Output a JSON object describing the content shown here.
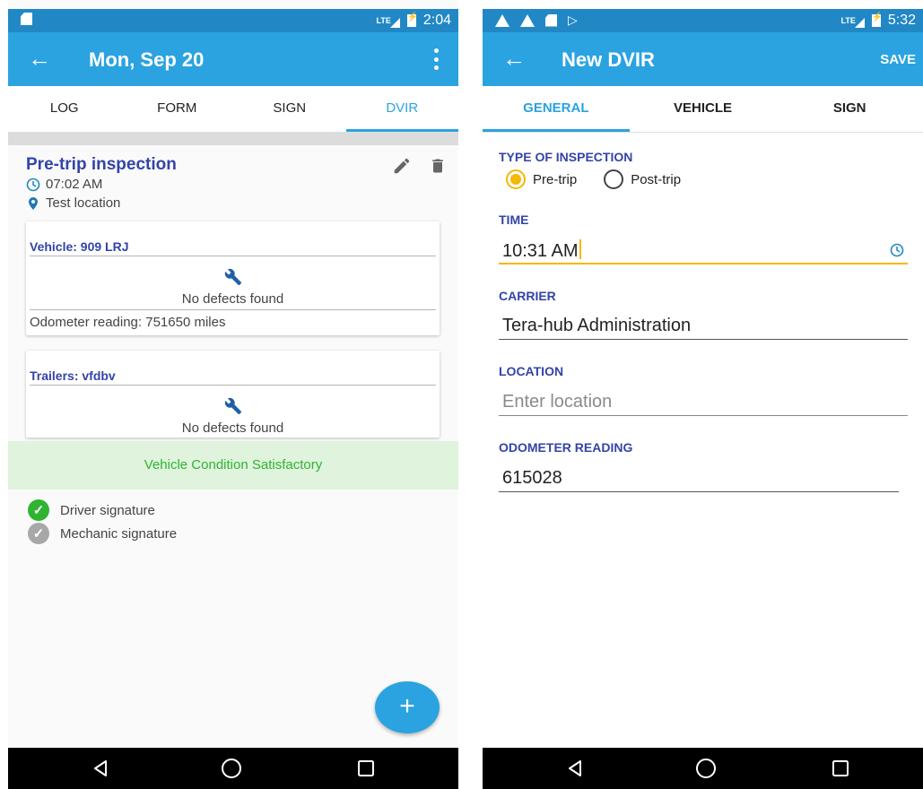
{
  "left": {
    "status": {
      "network": "LTE",
      "time": "2:04"
    },
    "appbar": {
      "title": "Mon, Sep 20"
    },
    "tabs": [
      "LOG",
      "FORM",
      "SIGN",
      "DVIR"
    ],
    "active_tab": "DVIR",
    "inspection": {
      "title": "Pre-trip inspection",
      "time": "07:02 AM",
      "location": "Test location"
    },
    "vehicle_card": {
      "title": "Vehicle: 909 LRJ",
      "defects": "No defects found",
      "odometer": "Odometer reading: 751650 miles"
    },
    "trailer_card": {
      "title": "Trailers: vfdbv",
      "defects": "No defects found"
    },
    "condition": "Vehicle Condition Satisfactory",
    "signatures": {
      "driver": "Driver signature",
      "mechanic": "Mechanic signature"
    },
    "fab_label": "+"
  },
  "right": {
    "status": {
      "network": "LTE",
      "time": "5:32"
    },
    "appbar": {
      "title": "New DVIR",
      "action": "SAVE"
    },
    "tabs": [
      "GENERAL",
      "VEHICLE",
      "SIGN"
    ],
    "active_tab": "GENERAL",
    "form": {
      "type_label": "TYPE OF INSPECTION",
      "type_options": [
        "Pre-trip",
        "Post-trip"
      ],
      "type_selected": "Pre-trip",
      "time_label": "TIME",
      "time_value": "10:31 AM",
      "carrier_label": "CARRIER",
      "carrier_value": "Tera-hub Administration",
      "location_label": "LOCATION",
      "location_placeholder": "Enter location",
      "odometer_label": "ODOMETER READING",
      "odometer_value": "615028"
    }
  },
  "colors": {
    "status_bar": "#2288c5",
    "app_bar": "#2aa3e0",
    "title_blue": "#3344a8",
    "accent_yellow": "#f5b800",
    "success_green": "#2fb432",
    "success_bg": "#dff3dd"
  }
}
